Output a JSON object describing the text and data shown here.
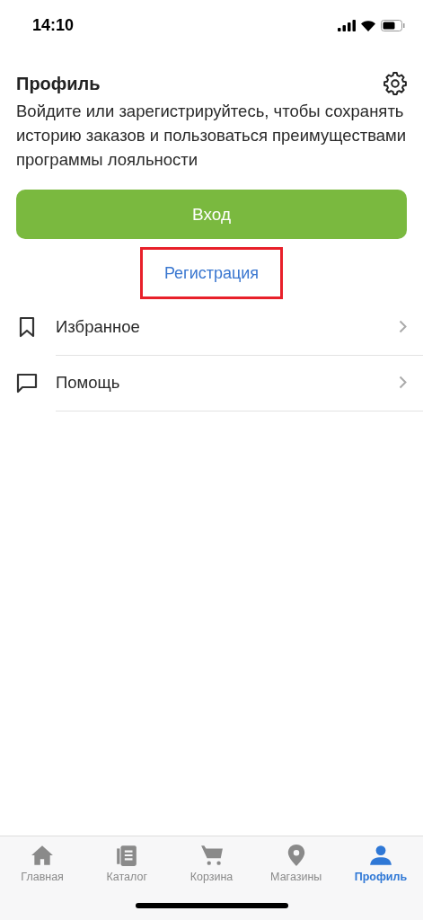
{
  "status_bar": {
    "time": "14:10"
  },
  "header": {
    "title": "Профиль"
  },
  "description": "Войдите или зарегистрируйтесь, чтобы сохранять историю заказов и пользоваться преимуществами программы лояльности",
  "login_button": {
    "label": "Вход"
  },
  "register_link": {
    "label": "Регистрация",
    "highlighted": true
  },
  "menu_items": [
    {
      "kind": "bookmark",
      "label": "Избранное"
    },
    {
      "kind": "chat",
      "label": "Помощь"
    }
  ],
  "tabs": [
    {
      "kind": "home",
      "label": "Главная",
      "selected": false
    },
    {
      "kind": "catalog",
      "label": "Каталог",
      "selected": false
    },
    {
      "kind": "cart",
      "label": "Корзина",
      "selected": false
    },
    {
      "kind": "pin",
      "label": "Магазины",
      "selected": false
    },
    {
      "kind": "person",
      "label": "Профиль",
      "selected": true
    }
  ]
}
